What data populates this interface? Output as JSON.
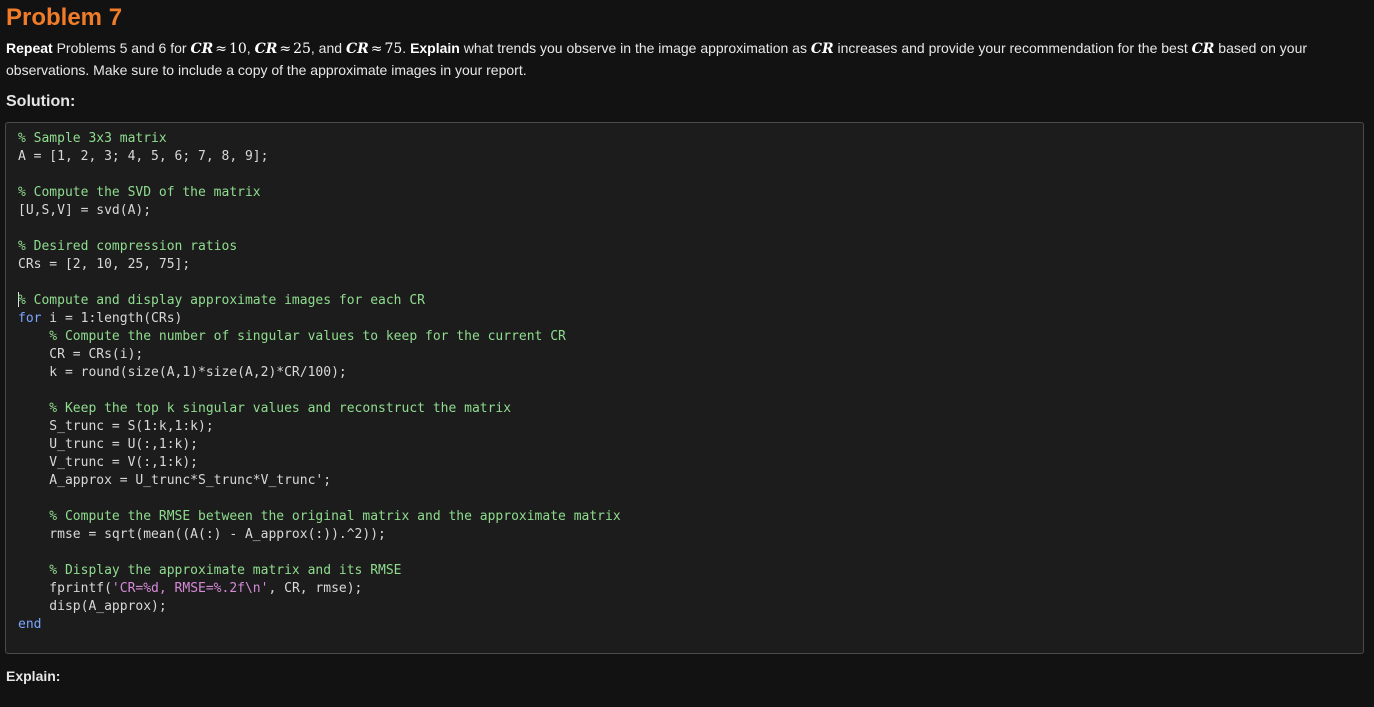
{
  "title": "Problem 7",
  "prompt": {
    "repeat": "Repeat",
    "part1": " Problems 5 and 6 for ",
    "cr": "CR",
    "approx": "≈",
    "v10": "10",
    "sep1": ", ",
    "v25": "25",
    "sep2": ", and ",
    "v75": "75",
    "part2": ". ",
    "explain": "Explain",
    "part3": " what trends you observe in the image approximation as ",
    "part4": " increases and provide your recommendation for the best ",
    "part5": " based on your observations. Make sure to include a copy of the approximate images in your report."
  },
  "solution_label": "Solution:",
  "code": {
    "l1": "% Sample 3x3 matrix",
    "l2": "A = [1, 2, 3; 4, 5, 6; 7, 8, 9];",
    "l4": "% Compute the SVD of the matrix",
    "l5": "[U,S,V] = svd(A);",
    "l7": "% Desired compression ratios",
    "l8": "CRs = [2, 10, 25, 75];",
    "l10": "% Compute and display approximate images for each CR",
    "l11_kw": "for",
    "l11": " i = 1:length(CRs)",
    "l12": "    % Compute the number of singular values to keep for the current CR",
    "l13": "    CR = CRs(i);",
    "l14": "    k = round(size(A,1)*size(A,2)*CR/100);",
    "l16": "    % Keep the top k singular values and reconstruct the matrix",
    "l17": "    S_trunc = S(1:k,1:k);",
    "l18": "    U_trunc = U(:,1:k);",
    "l19": "    V_trunc = V(:,1:k);",
    "l20": "    A_approx = U_trunc*S_trunc*V_trunc';",
    "l22": "    % Compute the RMSE between the original matrix and the approximate matrix",
    "l23": "    rmse = sqrt(mean((A(:) - A_approx(:)).^2));",
    "l25": "    % Display the approximate matrix and its RMSE",
    "l26a": "    fprintf(",
    "l26s": "'CR=%d, RMSE=%.2f\\n'",
    "l26b": ", CR, rmse);",
    "l27": "    disp(A_approx);",
    "l28_kw": "end"
  },
  "explain_label": "Explain:",
  "colors": {
    "title": "#f07c2a",
    "comment": "#8fdc8f",
    "keyword": "#7aa6ff",
    "string": "#d58ad8"
  }
}
